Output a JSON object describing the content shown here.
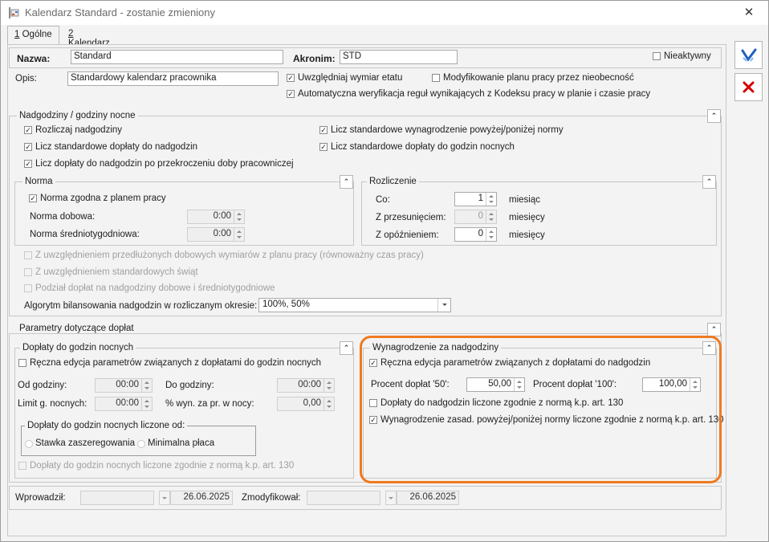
{
  "window": {
    "title": "Kalendarz Standard - zostanie zmieniony",
    "close": "✕"
  },
  "tabs": [
    {
      "key": "1",
      "rest": " Ogólne"
    },
    {
      "key": "2",
      "rest": " Kalendarz"
    }
  ],
  "header": {
    "name_label": "Nazwa:",
    "name_value": "Standard",
    "acronym_label": "Akronim:",
    "acronym_value": "STD",
    "inactive_label": "Nieaktywny",
    "desc_label": "Opis:",
    "desc_value": "Standardowy kalendarz pracownika",
    "opt_etat": "Uwzględniaj wymiar etatu",
    "opt_modify": "Modyfikowanie planu pracy przez nieobecność",
    "opt_auto": "Automatyczna weryfikacja reguł wynikających z Kodeksu pracy w planie i czasie pracy"
  },
  "overtime": {
    "title": "Nadgodziny / godziny nocne",
    "settle": "Rozliczaj nadgodziny",
    "std_surcharges": "Licz standardowe dopłaty do nadgodzin",
    "surcharges_day": "Licz dopłaty do nadgodzin po przekroczeniu doby pracowniczej",
    "std_pay": "Licz standardowe wynagrodzenie powyżej/poniżej  normy",
    "std_night": "Licz standardowe dopłaty do godzin nocnych",
    "norma": {
      "title": "Norma",
      "plan": "Norma zgodna z planem pracy",
      "daily_label": "Norma dobowa:",
      "daily_value": "0:00",
      "weekly_label": "Norma średniotygodniowa:",
      "weekly_value": "0:00"
    },
    "rozliczenie": {
      "title": "Rozliczenie",
      "co_label": "Co:",
      "co_value": "1",
      "co_unit": "miesiąc",
      "shift_label": "Z przesunięciem:",
      "shift_value": "0",
      "shift_unit": "miesięcy",
      "delay_label": "Z opóźnieniem:",
      "delay_value": "0",
      "delay_unit": "miesięcy"
    },
    "ext1": "Z uwzględnieniem przedłużonych dobowych wymiarów z planu pracy (równoważny czas pracy)",
    "ext2": "Z uwzględnieniem standardowych świąt",
    "ext3": "Podział dopłat na nadgodziny dobowe i średniotygodniowe",
    "algo_label": "Algorytm bilansowania nadgodzin w rozliczanym okresie:",
    "algo_value": "100%, 50%"
  },
  "params": {
    "title": "Parametry dotyczące dopłat",
    "night": {
      "title": "Dopłaty do godzin nocnych",
      "manual": "Ręczna edycja parametrów związanych z dopłatami do godzin nocnych",
      "from_label": "Od godziny:",
      "from_value": "00:00",
      "to_label": "Do godziny:",
      "to_value": "00:00",
      "limit_label": "Limit g. nocnych:",
      "limit_value": "00:00",
      "pct_label": "% wyn. za pr. w nocy:",
      "pct_value": "0,00",
      "basis_title": "Dopłaty do godzin nocnych liczone od:",
      "radio1": "Stawka zaszeregowania",
      "radio2": "Minimalna płaca",
      "kp": "Dopłaty do godzin nocnych liczone zgodnie z normą k.p. art. 130"
    },
    "pay": {
      "title": "Wynagrodzenie za nadgodziny",
      "manual": "Ręczna edycja parametrów związanych z dopłatami do nadgodzin",
      "p50_label": "Procent dopłat '50':",
      "p50_value": "50,00",
      "p100_label": "Procent dopłat '100':",
      "p100_value": "100,00",
      "kp": "Dopłaty do nadgodzin liczone zgodnie z normą k.p. art. 130",
      "base_kp": "Wynagrodzenie zasad. powyżej/poniżej normy liczone zgodnie z normą k.p. art. 130"
    }
  },
  "footer": {
    "entered_label": "Wprowadził:",
    "entered_date": "26.06.2025",
    "modified_label": "Zmodyfikował:",
    "modified_date": "26.06.2025"
  },
  "icons": {
    "save": "save-icon",
    "cancel": "cancel-icon",
    "collapse": "chevron-up-icon"
  },
  "colors": {
    "highlight": "#f07a20",
    "cancel": "#d40000",
    "save": "#1f5fbf"
  }
}
